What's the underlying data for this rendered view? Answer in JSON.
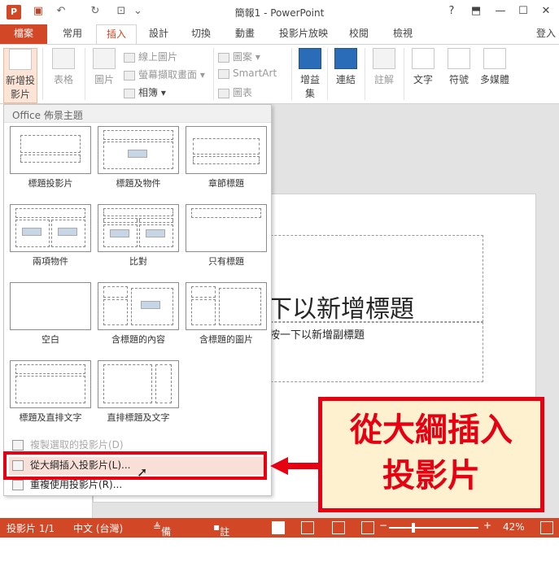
{
  "title": "簡報1 - PowerPoint",
  "window": {
    "help": "?",
    "restore": "⬒",
    "minimize": "—",
    "maximize": "☐",
    "close": "✕"
  },
  "quick_access": {
    "app": "P",
    "save": "💾",
    "undo": "↶",
    "redo": "↻",
    "present": "⊡"
  },
  "tabs": [
    "檔案",
    "常用",
    "插入",
    "設計",
    "切換",
    "動畫",
    "投影片放映",
    "校閱",
    "檢視"
  ],
  "active_tab": "插入",
  "sign_in": "登入",
  "ribbon": {
    "new_slide_l1": "新增投",
    "new_slide_l2": "影片",
    "table": "表格",
    "images": "圖片",
    "online_pictures": "線上圖片",
    "screenshot": "螢幕擷取畫面",
    "photo_album": "相簿",
    "shapes": "圖案",
    "smartart": "SmartArt",
    "chart": "圖表",
    "apps_l1": "增益",
    "apps_l2": "集",
    "links": "連結",
    "comment": "註解",
    "comments_group": "註解",
    "text": "文字",
    "symbols": "符號",
    "media": "多媒體"
  },
  "dropdown": {
    "header": "Office 佈景主題",
    "layouts": [
      "標題投影片",
      "標題及物件",
      "章節標題",
      "兩項物件",
      "比對",
      "只有標題",
      "空白",
      "含標題的內容",
      "含標題的圖片",
      "標題及直排文字",
      "直排標題及文字"
    ],
    "menu": {
      "duplicate": "複製選取的投影片(D)",
      "outline": "從大綱插入投影片(L)...",
      "reuse": "重複使用投影片(R)..."
    }
  },
  "slide": {
    "title_placeholder": "下以新增標題",
    "subtitle_placeholder": "按一下以新增副標題"
  },
  "callout": {
    "line1": "從大綱插入",
    "line2": "投影片"
  },
  "status": {
    "slide_count": "投影片 1/1",
    "language": "中文 (台灣)",
    "notes": "備忘稿",
    "comments": "註解",
    "zoom": "42%"
  },
  "colors": {
    "accent": "#d24726",
    "callout_red": "#e60012",
    "callout_bg": "#fdf1cf"
  }
}
